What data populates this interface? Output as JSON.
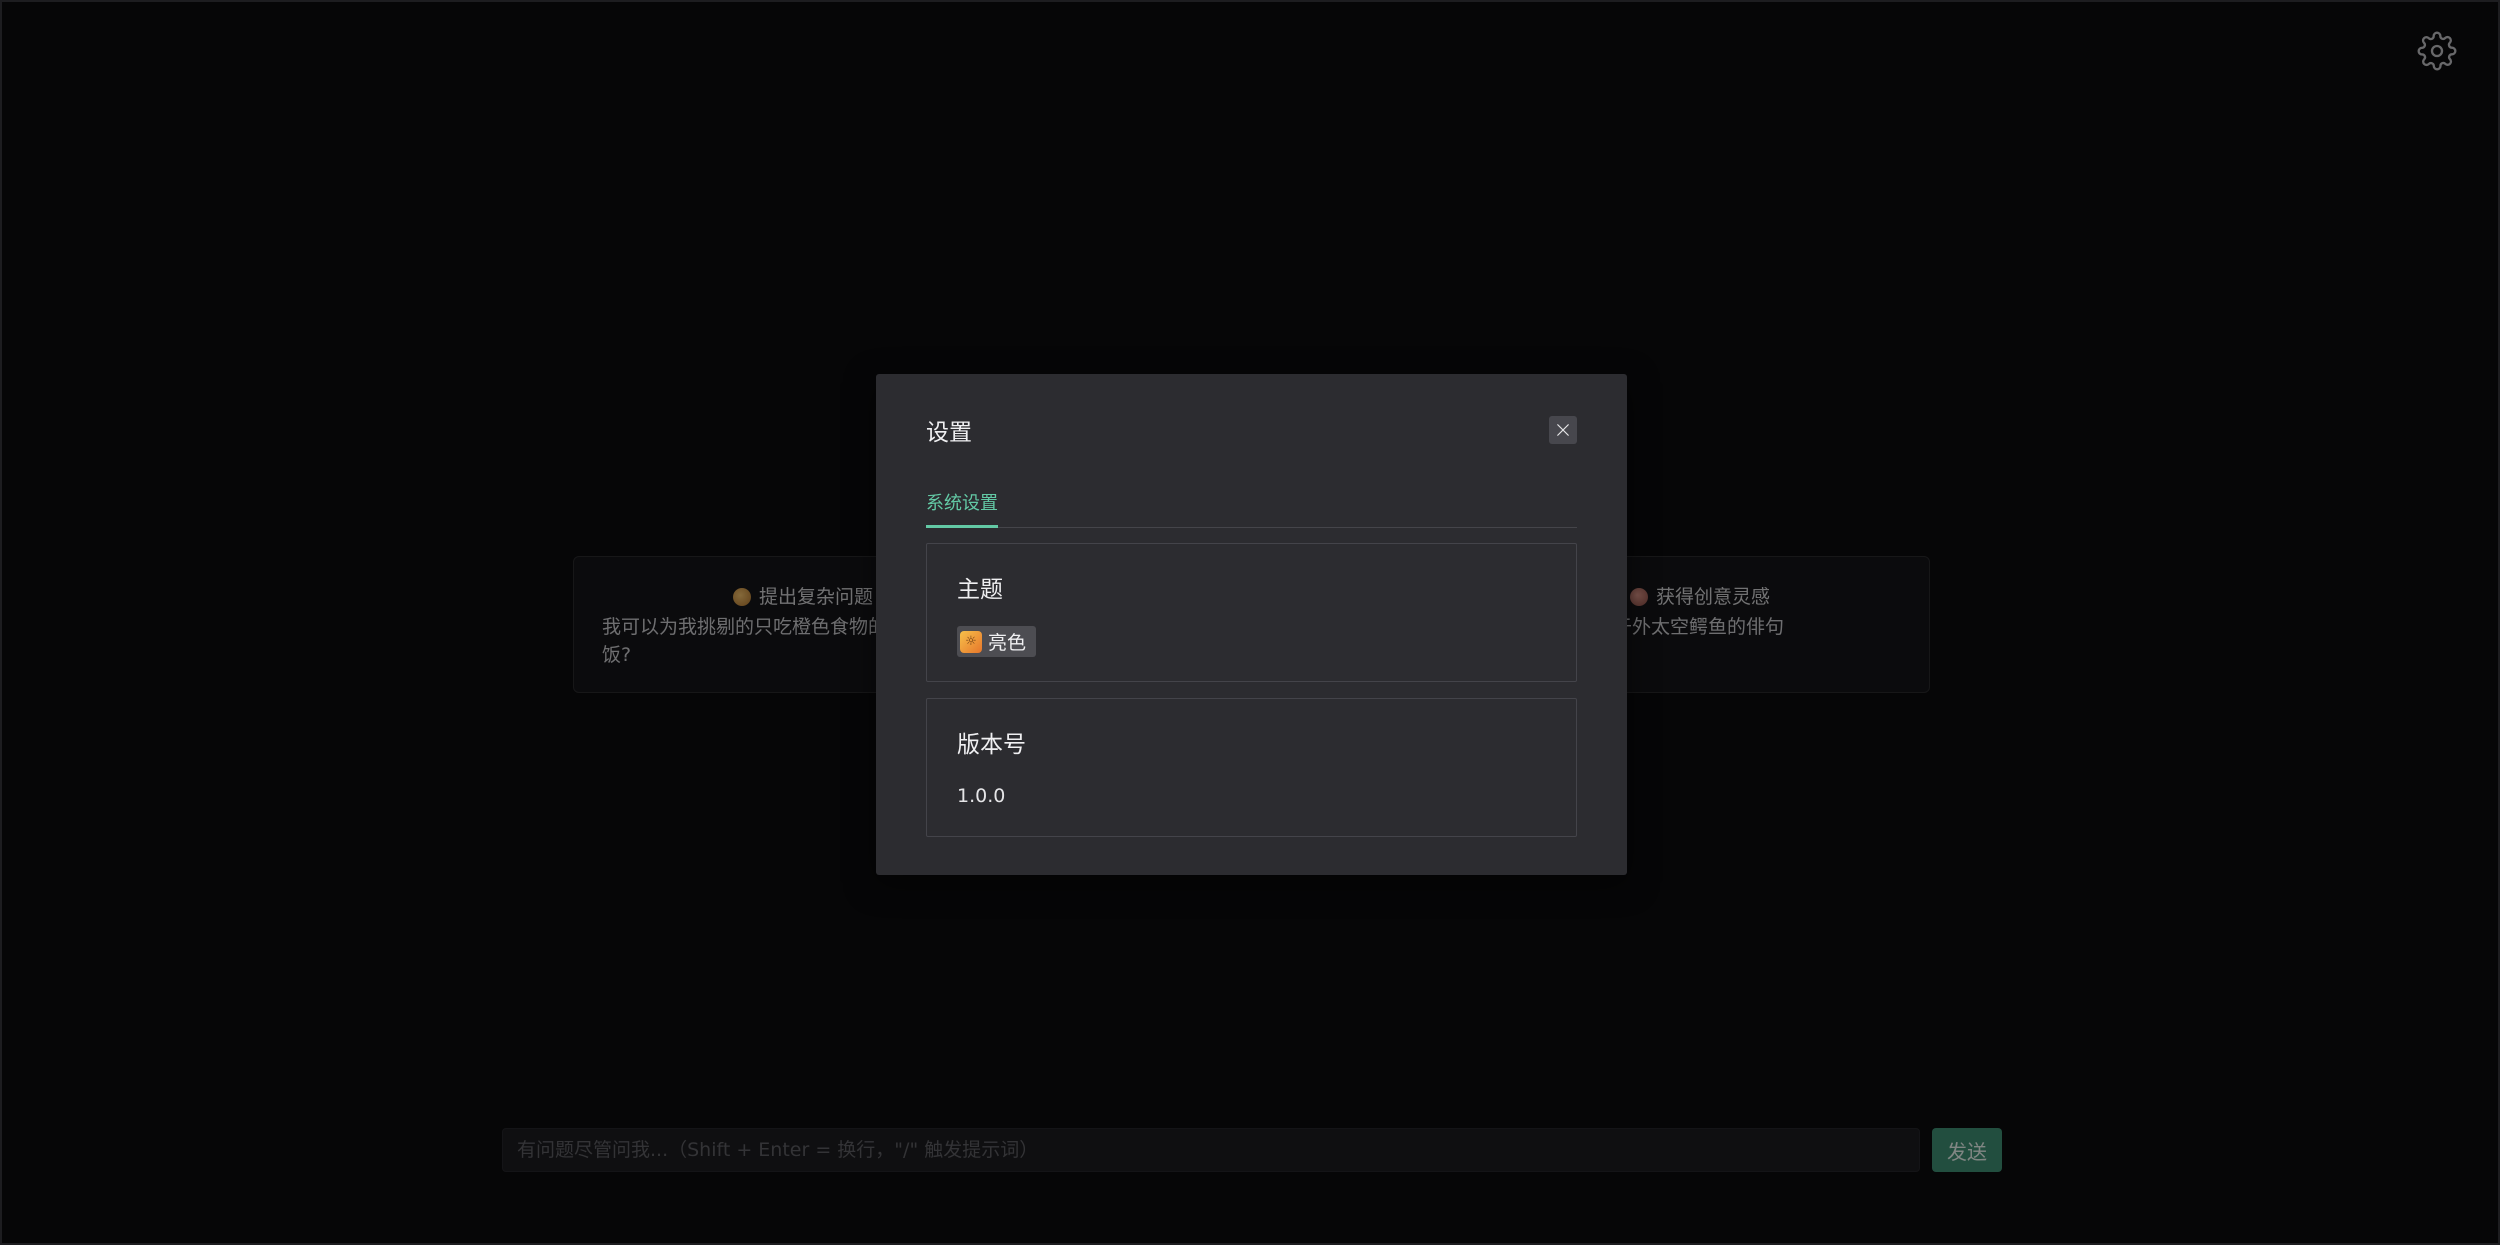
{
  "settings_icon": "gear-icon",
  "suggestions": [
    {
      "icon": "brain-emoji-icon",
      "title": "提出复杂问题",
      "body_line1": "我可以为我挑剔的只吃橙色食物的孩",
      "body_line2": "饭?"
    },
    {
      "icon": "palette-emoji-icon",
      "title": "获得创意灵感",
      "body_line1": "用吻写一首关于外太空鳄鱼的俳句",
      "body_line2": ""
    }
  ],
  "input": {
    "placeholder": "有问题尽管问我...（Shift + Enter = 换行，\"/\" 触发提示词）",
    "value": ""
  },
  "send_label": "发送",
  "modal": {
    "title": "设置",
    "close_icon": "close-icon",
    "tabs": [
      {
        "label": "系统设置",
        "active": true
      }
    ],
    "theme_section": {
      "title": "主题",
      "chip_label": "亮色",
      "chip_icon": "sun-emoji-icon"
    },
    "version_section": {
      "title": "版本号",
      "value": "1.0.0"
    }
  },
  "colors": {
    "background": "#0b0b0d",
    "modal_bg": "#2c2c30",
    "accent": "#63c9a5",
    "send_button": "#3f8f74"
  }
}
